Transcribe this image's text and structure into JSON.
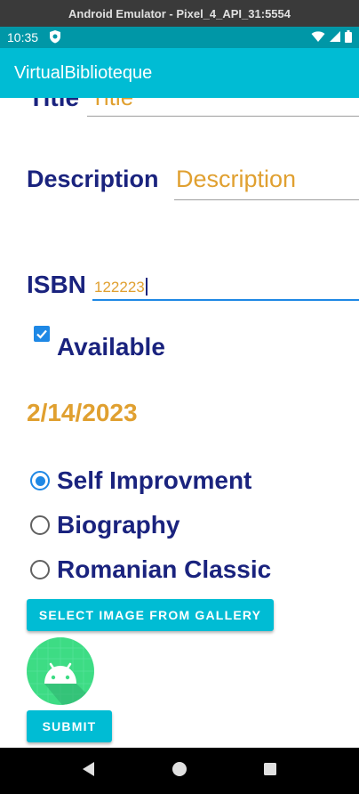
{
  "window": {
    "title": "Android Emulator - Pixel_4_API_31:5554"
  },
  "status_bar": {
    "time": "10:35"
  },
  "app_bar": {
    "title": "VirtualBiblioteque"
  },
  "form": {
    "title_label": "Title",
    "title_placeholder": "Title",
    "description_label": "Description",
    "description_placeholder": "Description",
    "isbn_label": "ISBN",
    "isbn_value": "122223",
    "available_label": "Available",
    "available_checked": true,
    "date": "2/14/2023",
    "categories": [
      {
        "label": "Self Improvment",
        "checked": true
      },
      {
        "label": "Biography",
        "checked": false
      },
      {
        "label": "Romanian Classic",
        "checked": false
      }
    ],
    "select_image_label": "SELECT IMAGE FROM GALLERY",
    "submit_label": "SUBMIT"
  },
  "colors": {
    "app_bar": "#00bcd4",
    "status_bar": "#0097a7",
    "label": "#1a237e",
    "hint": "#e0a030",
    "accent": "#1e88e5",
    "android_green": "#3ddc84"
  }
}
